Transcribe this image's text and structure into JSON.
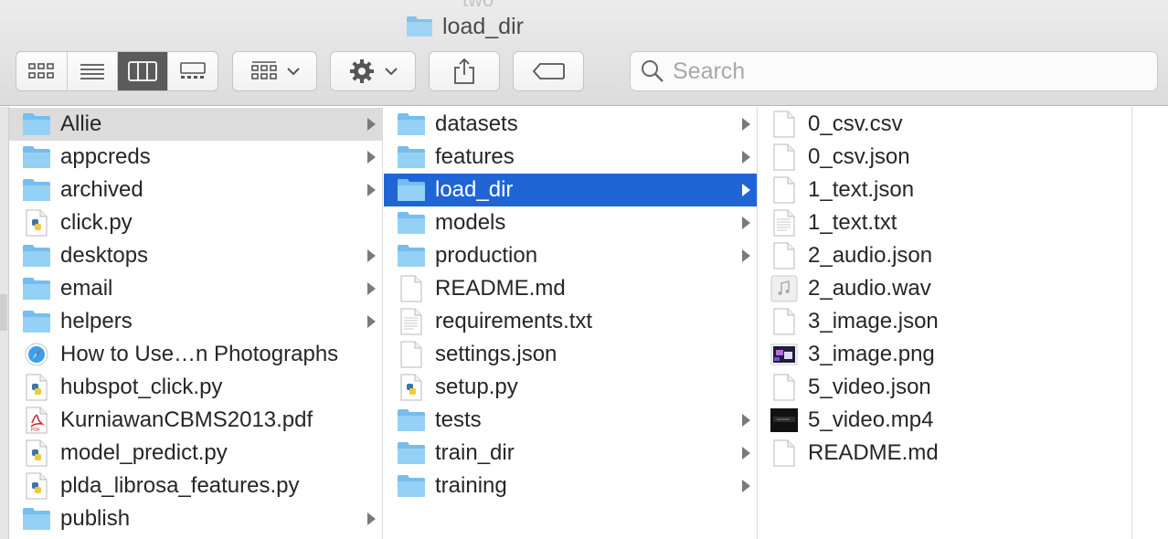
{
  "window": {
    "title": "load_dir",
    "ghost_tab_text": "two"
  },
  "toolbar": {
    "view_modes": [
      "icon-view",
      "list-view",
      "column-view",
      "gallery-view"
    ],
    "active_view": "column-view",
    "search_placeholder": "Search"
  },
  "columns": [
    {
      "items": [
        {
          "name": "Allie",
          "kind": "folder",
          "has_children": true,
          "state": "selected-inactive"
        },
        {
          "name": "appcreds",
          "kind": "folder",
          "has_children": true
        },
        {
          "name": "archived",
          "kind": "folder",
          "has_children": true
        },
        {
          "name": "click.py",
          "kind": "python"
        },
        {
          "name": "desktops",
          "kind": "folder",
          "has_children": true
        },
        {
          "name": "email",
          "kind": "folder",
          "has_children": true
        },
        {
          "name": "helpers",
          "kind": "folder",
          "has_children": true
        },
        {
          "name": "How to Use…n Photographs",
          "kind": "safari"
        },
        {
          "name": "hubspot_click.py",
          "kind": "python"
        },
        {
          "name": "KurniawanCBMS2013.pdf",
          "kind": "pdf"
        },
        {
          "name": "model_predict.py",
          "kind": "python"
        },
        {
          "name": "plda_librosa_features.py",
          "kind": "python"
        },
        {
          "name": "publish",
          "kind": "folder",
          "has_children": true
        }
      ]
    },
    {
      "items": [
        {
          "name": "datasets",
          "kind": "folder",
          "has_children": true
        },
        {
          "name": "features",
          "kind": "folder",
          "has_children": true
        },
        {
          "name": "load_dir",
          "kind": "folder",
          "has_children": true,
          "state": "selected-active"
        },
        {
          "name": "models",
          "kind": "folder",
          "has_children": true
        },
        {
          "name": "production",
          "kind": "folder",
          "has_children": true
        },
        {
          "name": "README.md",
          "kind": "doc"
        },
        {
          "name": "requirements.txt",
          "kind": "text"
        },
        {
          "name": "settings.json",
          "kind": "doc"
        },
        {
          "name": "setup.py",
          "kind": "python"
        },
        {
          "name": "tests",
          "kind": "folder",
          "has_children": true
        },
        {
          "name": "train_dir",
          "kind": "folder",
          "has_children": true
        },
        {
          "name": "training",
          "kind": "folder",
          "has_children": true
        }
      ]
    },
    {
      "items": [
        {
          "name": "0_csv.csv",
          "kind": "doc"
        },
        {
          "name": "0_csv.json",
          "kind": "doc"
        },
        {
          "name": "1_text.json",
          "kind": "doc"
        },
        {
          "name": "1_text.txt",
          "kind": "text"
        },
        {
          "name": "2_audio.json",
          "kind": "doc"
        },
        {
          "name": "2_audio.wav",
          "kind": "audio"
        },
        {
          "name": "3_image.json",
          "kind": "doc"
        },
        {
          "name": "3_image.png",
          "kind": "image"
        },
        {
          "name": "5_video.json",
          "kind": "doc"
        },
        {
          "name": "5_video.mp4",
          "kind": "video"
        },
        {
          "name": "README.md",
          "kind": "doc"
        }
      ]
    }
  ],
  "colors": {
    "selection_active": "#1f65d6",
    "selection_inactive": "#dcdcdc",
    "folder_blue": "#8ccaf3"
  }
}
